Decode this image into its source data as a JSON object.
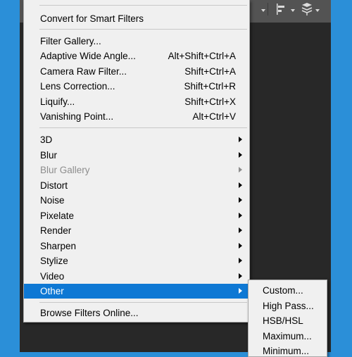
{
  "menu": {
    "items": [
      {
        "label": "Convert for Smart Filters",
        "shortcut": ""
      },
      {
        "label": "Filter Gallery...",
        "shortcut": ""
      },
      {
        "label": "Adaptive Wide Angle...",
        "shortcut": "Alt+Shift+Ctrl+A"
      },
      {
        "label": "Camera Raw Filter...",
        "shortcut": "Shift+Ctrl+A"
      },
      {
        "label": "Lens Correction...",
        "shortcut": "Shift+Ctrl+R"
      },
      {
        "label": "Liquify...",
        "shortcut": "Shift+Ctrl+X"
      },
      {
        "label": "Vanishing Point...",
        "shortcut": "Alt+Ctrl+V"
      },
      {
        "label": "3D",
        "shortcut": ""
      },
      {
        "label": "Blur",
        "shortcut": ""
      },
      {
        "label": "Blur Gallery",
        "shortcut": ""
      },
      {
        "label": "Distort",
        "shortcut": ""
      },
      {
        "label": "Noise",
        "shortcut": ""
      },
      {
        "label": "Pixelate",
        "shortcut": ""
      },
      {
        "label": "Render",
        "shortcut": ""
      },
      {
        "label": "Sharpen",
        "shortcut": ""
      },
      {
        "label": "Stylize",
        "shortcut": ""
      },
      {
        "label": "Video",
        "shortcut": ""
      },
      {
        "label": "Other",
        "shortcut": ""
      },
      {
        "label": "Browse Filters Online...",
        "shortcut": ""
      }
    ]
  },
  "submenu": {
    "items": [
      {
        "label": "Custom..."
      },
      {
        "label": "High Pass..."
      },
      {
        "label": "HSB/HSL"
      },
      {
        "label": "Maximum..."
      },
      {
        "label": "Minimum..."
      }
    ]
  },
  "toolbar": {
    "icons": [
      "align-icon",
      "distribute-icon"
    ]
  },
  "colors": {
    "desktop": "#2b8fd8",
    "menu_bg": "#f0f0f0",
    "highlight": "#0e78d4",
    "disabled_text": "#8d8d8d"
  }
}
